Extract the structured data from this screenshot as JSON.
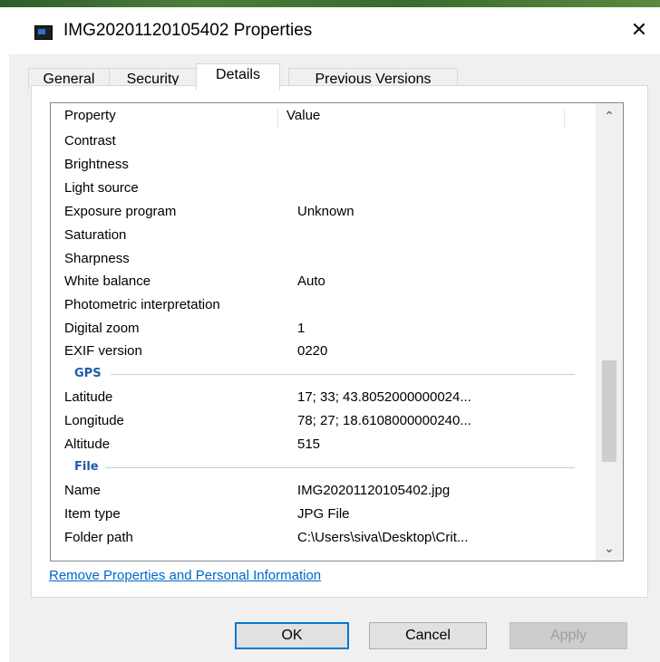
{
  "window": {
    "title": "IMG20201120105402 Properties",
    "close_glyph": "✕"
  },
  "tabs": [
    {
      "label": "General",
      "active": false
    },
    {
      "label": "Security",
      "active": false
    },
    {
      "label": "Details",
      "active": true
    },
    {
      "label": "Previous Versions",
      "active": false
    }
  ],
  "details": {
    "columns": {
      "property": "Property",
      "value": "Value"
    },
    "rows": [
      {
        "property": "Contrast",
        "value": ""
      },
      {
        "property": "Brightness",
        "value": ""
      },
      {
        "property": "Light source",
        "value": ""
      },
      {
        "property": "Exposure program",
        "value": "Unknown"
      },
      {
        "property": "Saturation",
        "value": ""
      },
      {
        "property": "Sharpness",
        "value": ""
      },
      {
        "property": "White balance",
        "value": "Auto"
      },
      {
        "property": "Photometric interpretation",
        "value": ""
      },
      {
        "property": "Digital zoom",
        "value": "1"
      },
      {
        "property": "EXIF version",
        "value": "0220"
      }
    ],
    "gps_group": "GPS",
    "gps_rows": [
      {
        "property": "Latitude",
        "value": "17; 33; 43.8052000000024..."
      },
      {
        "property": "Longitude",
        "value": "78; 27; 18.6108000000240..."
      },
      {
        "property": "Altitude",
        "value": "515"
      }
    ],
    "file_group": "File",
    "file_rows": [
      {
        "property": "Name",
        "value": "IMG20201120105402.jpg"
      },
      {
        "property": "Item type",
        "value": "JPG File"
      },
      {
        "property": "Folder path",
        "value": "C:\\Users\\siva\\Desktop\\Crit..."
      }
    ]
  },
  "scrollbar": {
    "up_glyph": "⌃",
    "down_glyph": "⌄"
  },
  "link_text": "Remove Properties and Personal Information",
  "buttons": {
    "ok": "OK",
    "cancel": "Cancel",
    "apply": "Apply"
  }
}
